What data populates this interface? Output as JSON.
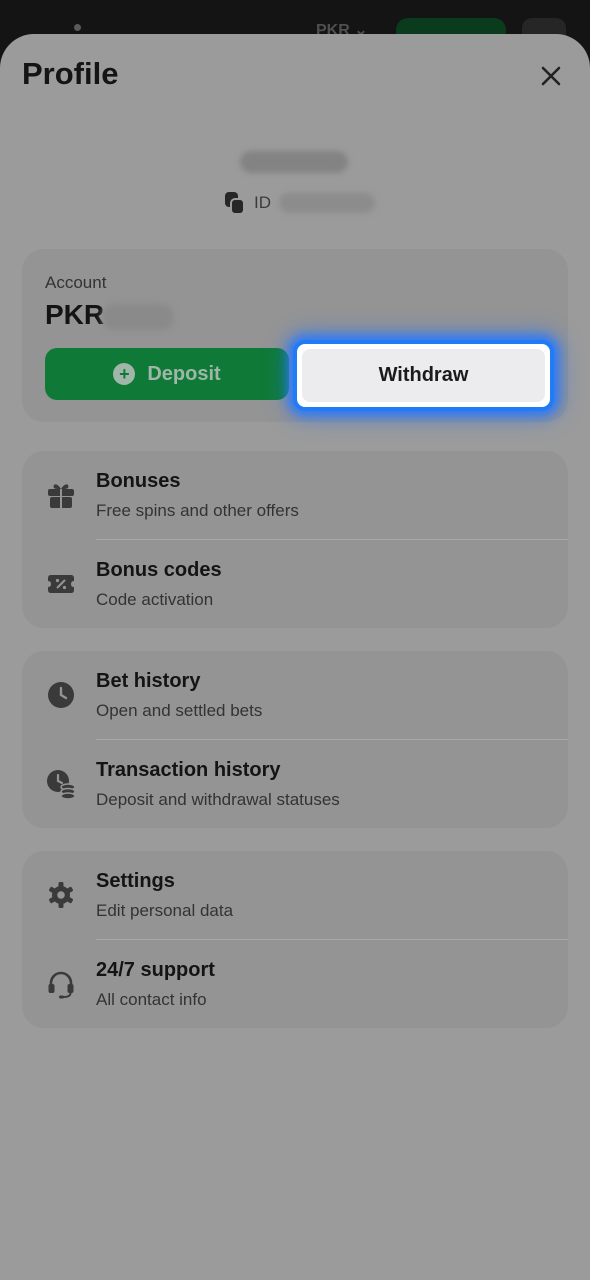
{
  "topbar": {
    "currency": "PKR"
  },
  "profile": {
    "title": "Profile",
    "id_label": "ID"
  },
  "account": {
    "label": "Account",
    "currency": "PKR",
    "deposit_label": "Deposit",
    "withdraw_label": "Withdraw"
  },
  "groups": [
    {
      "items": [
        {
          "title": "Bonuses",
          "subtitle": "Free spins and other offers",
          "icon": "gift-icon"
        },
        {
          "title": "Bonus codes",
          "subtitle": "Code activation",
          "icon": "ticket-icon"
        }
      ]
    },
    {
      "items": [
        {
          "title": "Bet history",
          "subtitle": "Open and settled bets",
          "icon": "clock-icon"
        },
        {
          "title": "Transaction history",
          "subtitle": "Deposit and withdrawal statuses",
          "icon": "clock-coins-icon"
        }
      ]
    },
    {
      "items": [
        {
          "title": "Settings",
          "subtitle": "Edit personal data",
          "icon": "gear-icon"
        },
        {
          "title": "24/7 support",
          "subtitle": "All contact info",
          "icon": "headset-icon"
        }
      ]
    }
  ],
  "colors": {
    "overlay": "#9b9b9b",
    "deposit": "#0f7a37",
    "highlight": "#1f7cf5"
  }
}
